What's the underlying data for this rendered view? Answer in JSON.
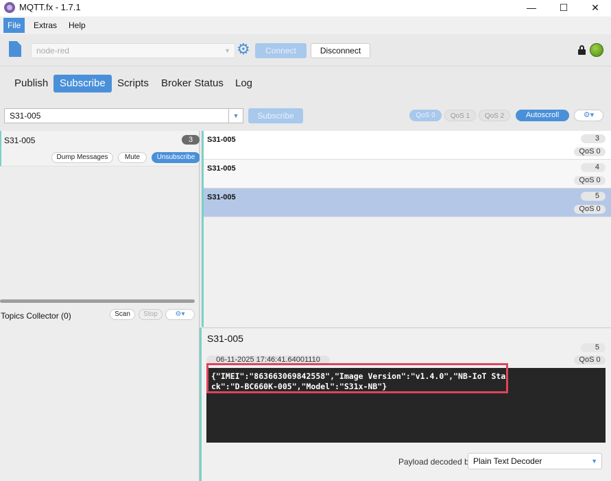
{
  "window": {
    "title": "MQTT.fx - 1.7.1",
    "min": "—",
    "max": "☐",
    "close": "✕"
  },
  "menu": {
    "items": [
      "File",
      "Extras",
      "Help"
    ]
  },
  "toolbar": {
    "profile": "node-red",
    "connect": "Connect",
    "disconnect": "Disconnect",
    "connected": true
  },
  "tabs": [
    "Publish",
    "Subscribe",
    "Scripts",
    "Broker Status",
    "Log"
  ],
  "subscribe_bar": {
    "topic": "S31-005",
    "subscribe": "Subscribe",
    "qos": [
      "QoS 0",
      "QoS 1",
      "QoS 2"
    ],
    "autoscroll": "Autoscroll",
    "options": "⚙▾"
  },
  "subscription": {
    "topic": "S31-005",
    "count": "3",
    "dump": "Dump Messages",
    "mute": "Mute",
    "unsubscribe": "Unsubscribe"
  },
  "collector": {
    "label": "Topics Collector (0)",
    "scan": "Scan",
    "stop": "Stop",
    "options": "⚙▾"
  },
  "messages": [
    {
      "topic": "S31-005",
      "num": "3",
      "qos": "QoS 0"
    },
    {
      "topic": "S31-005",
      "num": "4",
      "qos": "QoS 0"
    },
    {
      "topic": "S31-005",
      "num": "5",
      "qos": "QoS 0"
    }
  ],
  "detail": {
    "topic": "S31-005",
    "num": "5",
    "timestamp": "06-11-2025  17:46:41.64001110",
    "qos": "QoS 0",
    "payload": "{\"IMEI\":\"863663069842558\",\"Image Version\":\"v1.4.0\",\"NB-IoT Stack\":\"D-BC660K-005\",\"Model\":\"S31x-NB\"}",
    "decoder_label": "Payload decoded by",
    "decoder": "Plain Text Decoder"
  },
  "colors": {
    "accent": "#4a90d9",
    "highlight": "#e0445a",
    "led": "#6aaa24"
  }
}
